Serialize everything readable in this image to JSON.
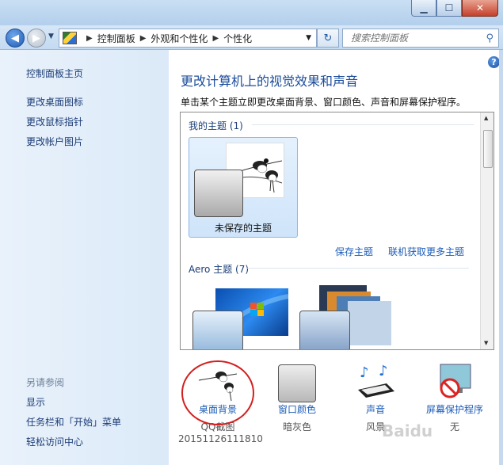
{
  "window": {
    "buttons": {
      "minimize": "▁",
      "maximize": "☐",
      "close": "✕"
    }
  },
  "navigation": {
    "address": {
      "root": "控制面板",
      "parent": "外观和个性化",
      "current": "个性化"
    },
    "search_placeholder": "搜索控制面板"
  },
  "sidebar": {
    "home": "控制面板主页",
    "links": [
      "更改桌面图标",
      "更改鼠标指针",
      "更改帐户图片"
    ],
    "see_also_title": "另请参阅",
    "see_also": [
      "显示",
      "任务栏和「开始」菜单",
      "轻松访问中心"
    ]
  },
  "main": {
    "title": "更改计算机上的视觉效果和声音",
    "description": "单击某个主题立即更改桌面背景、窗口颜色、声音和屏幕保护程序。",
    "my_themes": {
      "title": "我的主题 (1)",
      "selected_theme": "未保存的主题",
      "save_link": "保存主题",
      "online_link": "联机获取更多主题"
    },
    "aero_themes": {
      "title": "Aero 主题 (7)"
    }
  },
  "settings": [
    {
      "label": "桌面背景",
      "value": "QQ截图20151126111810"
    },
    {
      "label": "窗口颜色",
      "value": "暗灰色"
    },
    {
      "label": "声音",
      "value": "风景"
    },
    {
      "label": "屏幕保护程序",
      "value": "无"
    }
  ],
  "watermark": "Baidu"
}
